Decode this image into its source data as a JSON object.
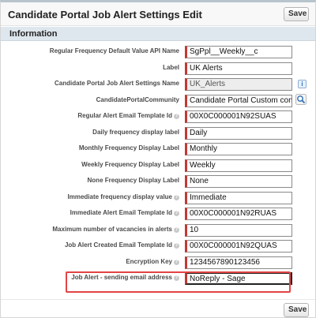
{
  "header": {
    "title": "Candidate Portal Job Alert Settings Edit",
    "save_label": "Save"
  },
  "section": {
    "title": "Information"
  },
  "fields": [
    {
      "label": "Regular Frequency Default Value API Name",
      "value": "SgPpl__Weekly__c",
      "help": false
    },
    {
      "label": "Label",
      "value": "UK Alerts",
      "help": false
    },
    {
      "label": "Candidate Portal Job Alert Settings Name",
      "value": "UK_Alerts",
      "help": false
    },
    {
      "label": "CandidatePortalCommunity",
      "value": "Candidate Portal Custom com",
      "help": false
    },
    {
      "label": "Regular Alert Email Template Id",
      "value": "00X0C000001N92SUAS",
      "help": true
    },
    {
      "label": "Daily frequency display label",
      "value": "Daily",
      "help": false
    },
    {
      "label": "Monthly Frequency Display Label",
      "value": "Monthly",
      "help": false
    },
    {
      "label": "Weekly Frequency Display Label",
      "value": "Weekly",
      "help": false
    },
    {
      "label": "None Frequency Display Label",
      "value": "None",
      "help": false
    },
    {
      "label": "Immediate frequency display value",
      "value": "Immediate",
      "help": true
    },
    {
      "label": "Immediate Alert Email Template Id",
      "value": "00X0C000001N92RUAS",
      "help": true
    },
    {
      "label": "Maximum number of vacancies in alerts",
      "value": "10",
      "help": true
    },
    {
      "label": "Job Alert Created Email Template Id",
      "value": "00X0C000001N92QUAS",
      "help": true
    },
    {
      "label": "Encryption Key",
      "value": "1234567890123456",
      "help": true
    },
    {
      "label": "Job Alert - sending email address",
      "value": "NoReply - Sage",
      "help": true
    }
  ],
  "footer": {
    "save_label": "Save"
  },
  "colors": {
    "required_bar": "#c23934",
    "highlight": "#e24444",
    "section_bg": "#dfe7ee"
  },
  "icons": {
    "info": "info-icon",
    "lookup": "magnifier-lookup-icon",
    "help": "help-icon"
  }
}
